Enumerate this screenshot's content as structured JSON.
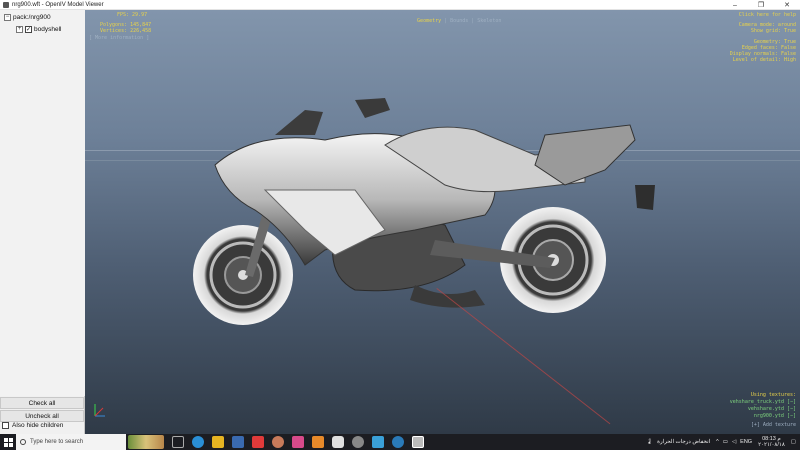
{
  "window": {
    "title": "nrg900.wft - OpenIV Model Viewer",
    "min": "–",
    "max": "❐",
    "close": "✕"
  },
  "tree": {
    "root": "pack:/nrg900",
    "child": "bodyshell"
  },
  "buttons": {
    "check_all": "Check all",
    "uncheck_all": "Uncheck all",
    "also_hide_children": "Also hide children"
  },
  "hud": {
    "fps": "FPS: 29.97",
    "polygons": "Polygons: 145,847",
    "vertices": "Vertices: 226,458",
    "more_info": "[ More information ]",
    "mode_geometry": "Geometry",
    "mode_bounds": "Bounds",
    "mode_skeleton": "Skeleton",
    "separator": " | ",
    "help": "Click here for help",
    "camera": "Camera mode: around",
    "show_grid": "Show grid: True",
    "geometry": "Geometry: True",
    "edged_faces": "Edged faces: False",
    "display_normals": "Display normals: False",
    "level_of_detail": "Level of detail: High",
    "using_textures": "Using textures:",
    "tex1": "vehshare_truck.ytd [−]",
    "tex2": "vehshare.ytd [−]",
    "tex3": "nrg900.ytd [−]",
    "add_texture": "[+] Add texture"
  },
  "taskbar": {
    "search_placeholder": "Type here to search",
    "weather": "انخفاض درجات الحرارة",
    "lang": "ENG",
    "time": "08:13 م",
    "date": "٢٠٢١/٠٨/١٨"
  },
  "colors": {
    "hud_yellow": "#e8d24a",
    "hud_blue": "#9fb0c2",
    "taskbar": "#1c1d22"
  }
}
